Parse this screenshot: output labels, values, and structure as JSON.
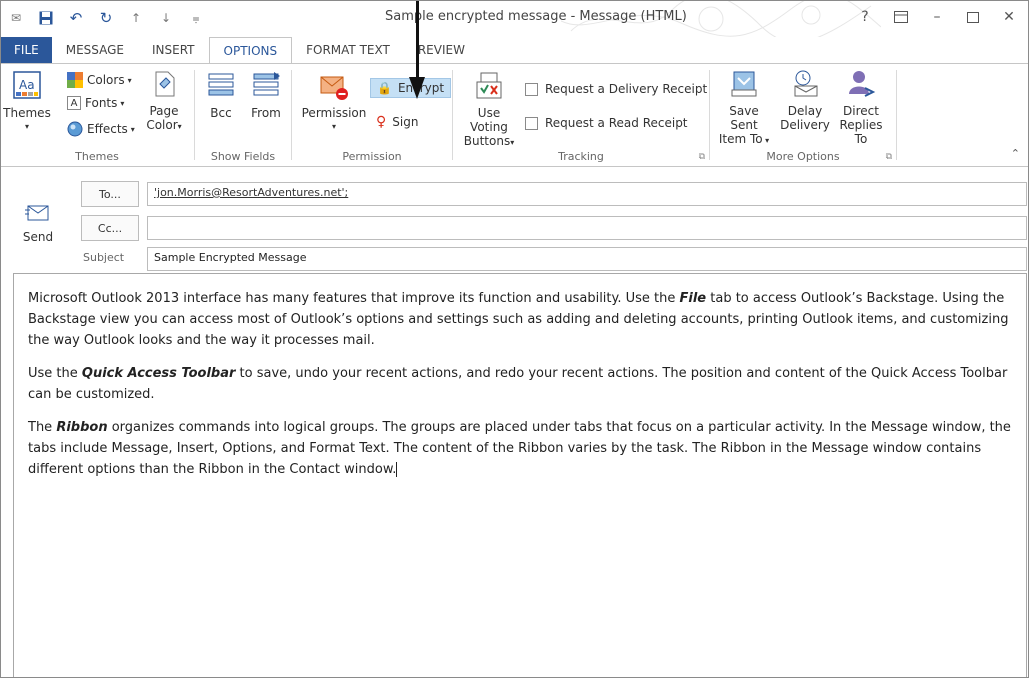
{
  "window": {
    "title": "Sample encrypted message - Message (HTML)"
  },
  "tabs": [
    {
      "label": "FILE"
    },
    {
      "label": "MESSAGE"
    },
    {
      "label": "INSERT"
    },
    {
      "label": "OPTIONS"
    },
    {
      "label": "FORMAT TEXT"
    },
    {
      "label": "REVIEW"
    }
  ],
  "ribbon": {
    "themes": {
      "themes_label": "Themes",
      "colors_label": "Colors",
      "fonts_label": "Fonts",
      "effects_label": "Effects",
      "page_color_label_1": "Page",
      "page_color_label_2": "Color",
      "group_label": "Themes"
    },
    "show_fields": {
      "bcc_label": "Bcc",
      "from_label": "From",
      "group_label": "Show Fields"
    },
    "permission": {
      "permission_label": "Permission",
      "encrypt_label": "Encrypt",
      "sign_label": "Sign",
      "group_label": "Permission"
    },
    "tracking": {
      "voting_label_1": "Use Voting",
      "voting_label_2": "Buttons",
      "delivery_receipt_label": "Request a Delivery Receipt",
      "read_receipt_label": "Request a Read Receipt",
      "group_label": "Tracking"
    },
    "more_options": {
      "save_sent_1": "Save Sent",
      "save_sent_2": "Item To",
      "delay_1": "Delay",
      "delay_2": "Delivery",
      "direct_1": "Direct",
      "direct_2": "Replies To",
      "group_label": "More Options"
    }
  },
  "message": {
    "send_label": "Send",
    "to_button": "To...",
    "cc_button": "Cc...",
    "subject_label": "Subject",
    "to_value": "'jon.Morris@ResortAdventures.net';",
    "cc_value": "",
    "subject_value": "Sample Encrypted Message"
  },
  "body": {
    "p1_a": "Microsoft Outlook 2013 interface has many features that improve its function and usability. Use the ",
    "p1_b": "File",
    "p1_c": " tab to access Outlook’s Backstage. Using the Backstage view you can access most of Outlook’s options and settings such as adding and deleting accounts, printing Outlook items, and customizing the way Outlook looks and the way it processes mail.",
    "p2_a": "Use the ",
    "p2_b": "Quick Access Toolbar",
    "p2_c": " to save, undo your recent actions, and redo your recent actions. The position and content of the Quick Access Toolbar can be customized.",
    "p3_a": "The ",
    "p3_b": "Ribbon",
    "p3_c": " organizes commands into logical groups. The groups are placed under tabs that focus on a particular activity. In the Message window, the tabs include Message, Insert, Options, and Format Text. The content of the Ribbon varies by the task. The Ribbon in the Message window contains different options than the Ribbon in the Contact window."
  },
  "colors": {
    "accent": "#2b579a",
    "encrypt_highlight": "#c5e0f5"
  }
}
